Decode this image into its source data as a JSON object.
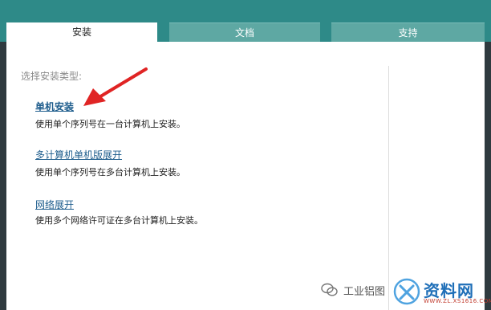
{
  "tabs": [
    {
      "label": "安装",
      "active": true
    },
    {
      "label": "文档",
      "active": false
    },
    {
      "label": "支持",
      "active": false
    }
  ],
  "panel": {
    "prompt": "选择安装类型:",
    "options": [
      {
        "title": "单机安装",
        "desc": "使用单个序列号在一台计算机上安装。"
      },
      {
        "title": "多计算机单机版展开",
        "desc": "使用单个序列号在多台计算机上安装。"
      },
      {
        "title": "网络展开",
        "desc": "使用多个网络许可证在多台计算机上安装。"
      }
    ]
  },
  "watermark": {
    "account_text": "工业铝图",
    "brand": "资料网",
    "url": "WWW.ZL.XS1616.COM"
  },
  "colors": {
    "header_bg": "#2e8a88",
    "tab_inactive": "#5ea8a3",
    "link": "#1d5c8c",
    "arrow": "#e02424"
  }
}
